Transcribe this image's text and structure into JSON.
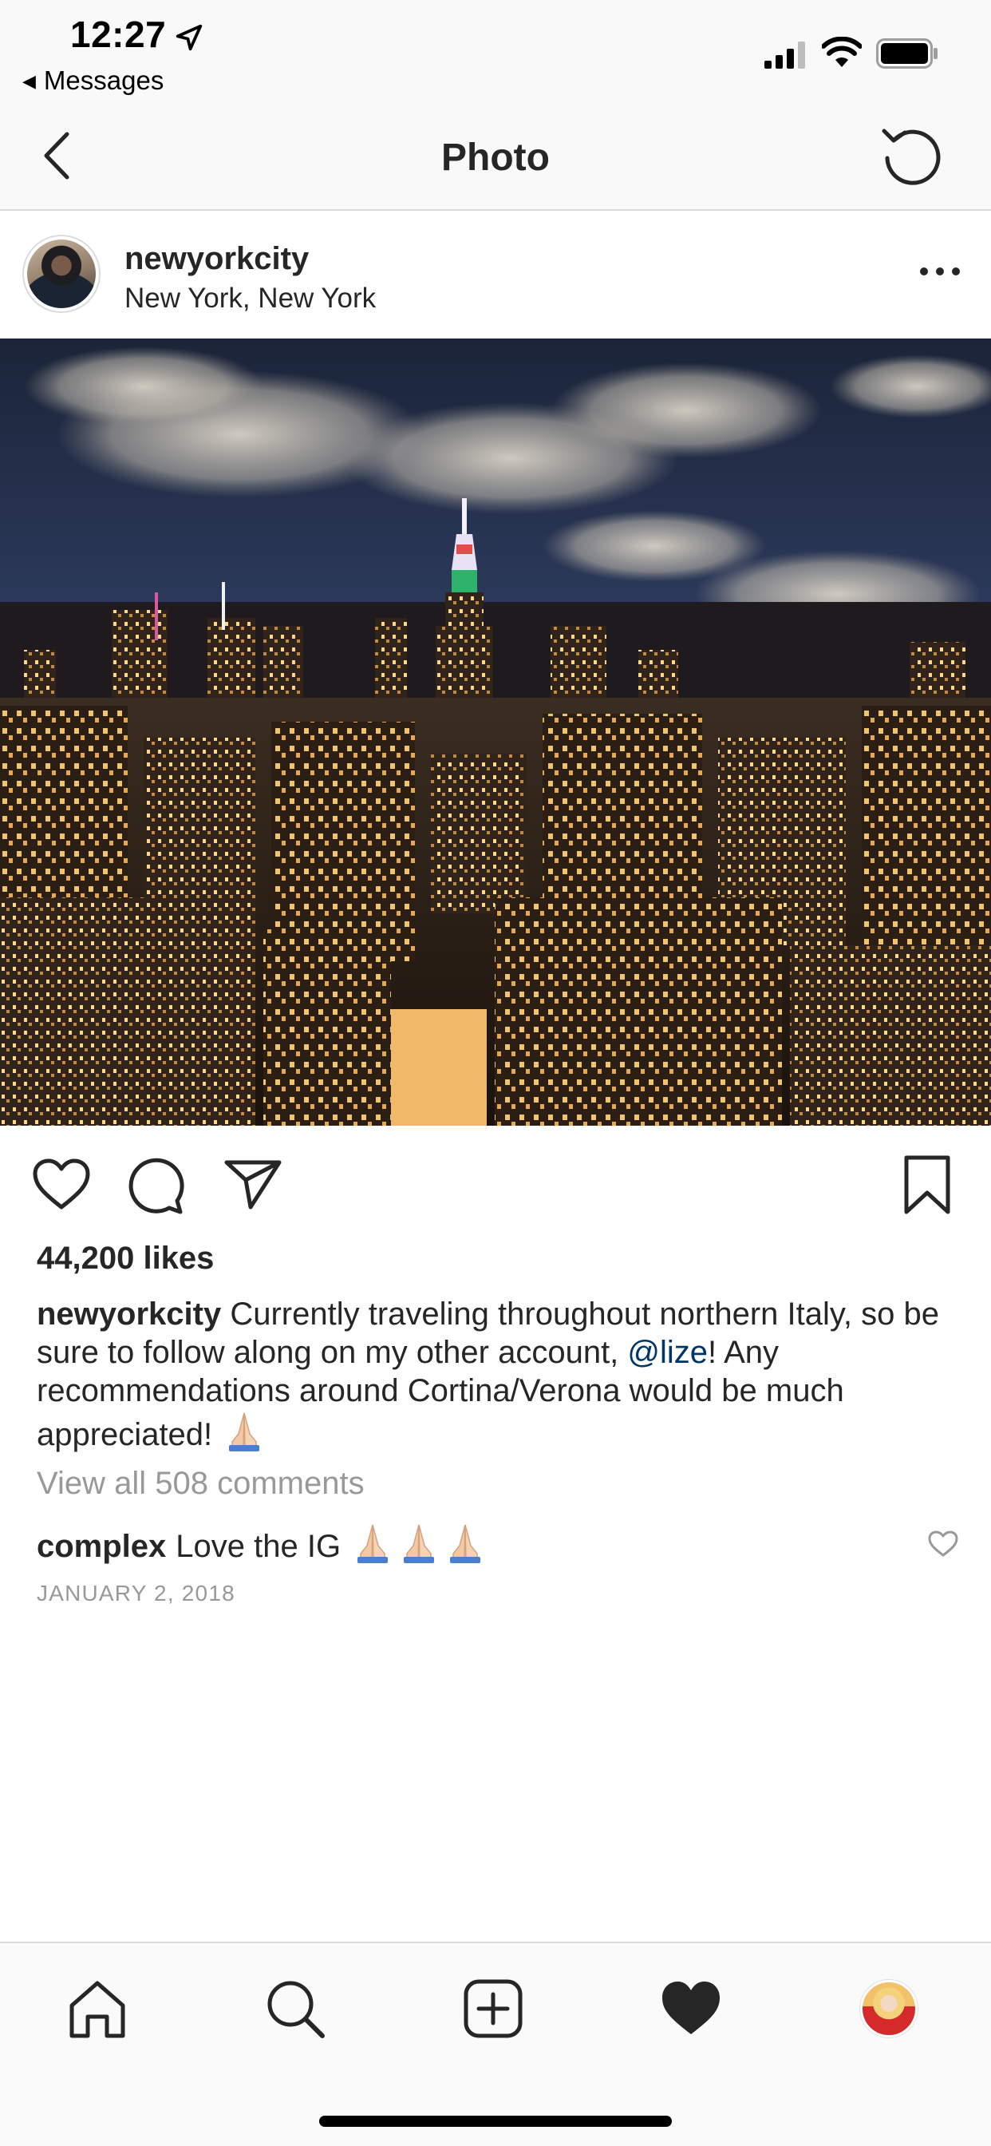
{
  "status_bar": {
    "time": "12:27",
    "back_label": "Messages",
    "icons": [
      "location-arrow-icon",
      "cellular-signal-icon",
      "wifi-icon",
      "battery-icon"
    ]
  },
  "nav": {
    "title": "Photo",
    "back_icon": "chevron-left-icon",
    "right_icon": "refresh-icon"
  },
  "post": {
    "username": "newyorkcity",
    "location": "New York, New York",
    "more_icon": "more-horizontal-icon",
    "photo_alt": "New York City skyline at night with the Empire State Building",
    "actions": {
      "like_icon": "heart-outline-icon",
      "comment_icon": "comment-bubble-icon",
      "share_icon": "paper-plane-icon",
      "save_icon": "bookmark-icon"
    },
    "likes": "44,200 likes",
    "caption": {
      "username": "newyorkcity",
      "text_before_mention": " Currently traveling throughout northern Italy, so be sure to follow along on my other account, ",
      "mention": "@lize",
      "text_after_mention": "! Any recommendations around Cortina/Verona would be much appreciated! ",
      "emoji": "folded-hands-emoji"
    },
    "view_all_comments": "View all 508 comments",
    "comment": {
      "username": "complex",
      "text": "Love the IG ",
      "emoji_count": 3,
      "like_icon": "small-heart-icon"
    },
    "date": "JANUARY 2, 2018"
  },
  "tab_bar": {
    "tabs": [
      {
        "name": "home",
        "icon": "home-icon"
      },
      {
        "name": "search",
        "icon": "search-icon"
      },
      {
        "name": "new-post",
        "icon": "plus-square-icon"
      },
      {
        "name": "activity",
        "icon": "heart-filled-icon"
      },
      {
        "name": "profile",
        "icon": "profile-avatar"
      }
    ]
  },
  "colors": {
    "text": "#262626",
    "secondary_text": "#999999",
    "mention": "#003569",
    "bar_background": "#f9f9f9",
    "divider": "#dbdbdb"
  }
}
